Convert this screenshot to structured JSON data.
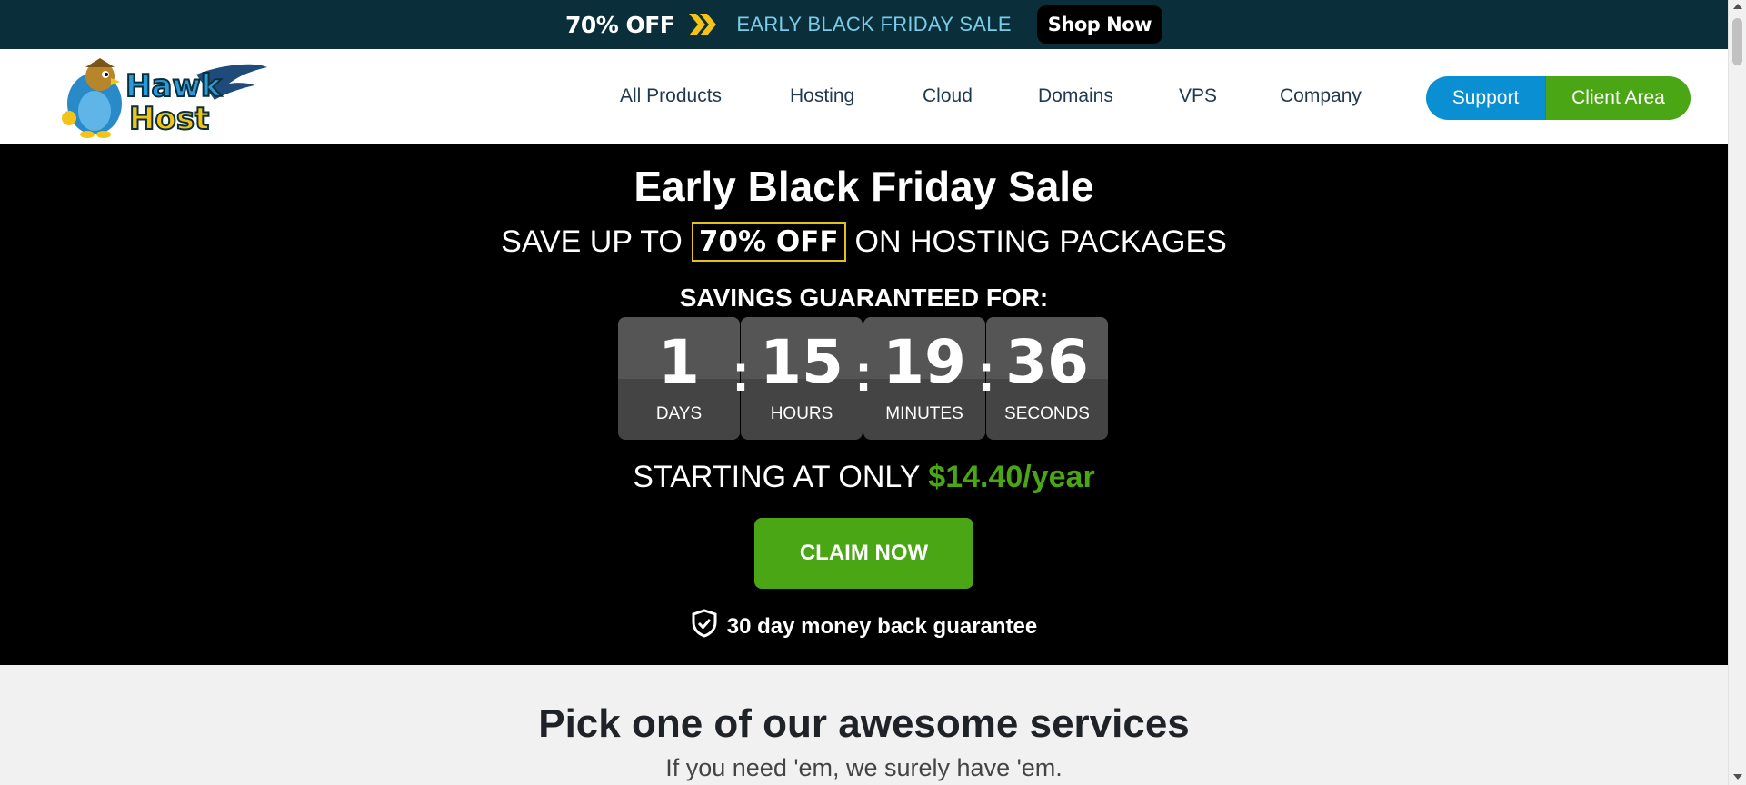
{
  "promo": {
    "off_text": "70% OFF",
    "sale_text": "EARLY BLACK FRIDAY SALE",
    "shop_label": "Shop Now",
    "arrow_icon": "double-chevron-right-icon",
    "arrow_color": "#f2c418"
  },
  "header": {
    "logo_text": "Hawk Host",
    "nav": [
      "All Products",
      "Hosting",
      "Cloud",
      "Domains",
      "VPS",
      "Company"
    ],
    "support_label": "Support",
    "client_area_label": "Client Area"
  },
  "hero": {
    "title": "Early Black Friday Sale",
    "sub_before": "SAVE UP TO",
    "sub_highlight": "70% OFF",
    "sub_after": "ON HOSTING PACKAGES",
    "guarantee_label": "SAVINGS GUARANTEED FOR:",
    "countdown": {
      "days": "1",
      "days_label": "DAYS",
      "hours": "15",
      "hours_label": "HOURS",
      "minutes": "19",
      "minutes_label": "MINUTES",
      "seconds": "36",
      "seconds_label": "SECONDS",
      "separator": ":"
    },
    "start_text": "STARTING AT ONLY",
    "price": "$14.40/year",
    "claim_label": "CLAIM NOW",
    "money_back": "30 day money back guarantee",
    "shield_icon": "shield-check-icon"
  },
  "services": {
    "title": "Pick one of our awesome services",
    "subtitle": "If you need 'em, we surely have 'em."
  },
  "colors": {
    "promo_bg": "#0b2e3b",
    "accent_green": "#4aa614",
    "accent_blue": "#0a8fd2",
    "highlight_border": "#e0c21a"
  }
}
